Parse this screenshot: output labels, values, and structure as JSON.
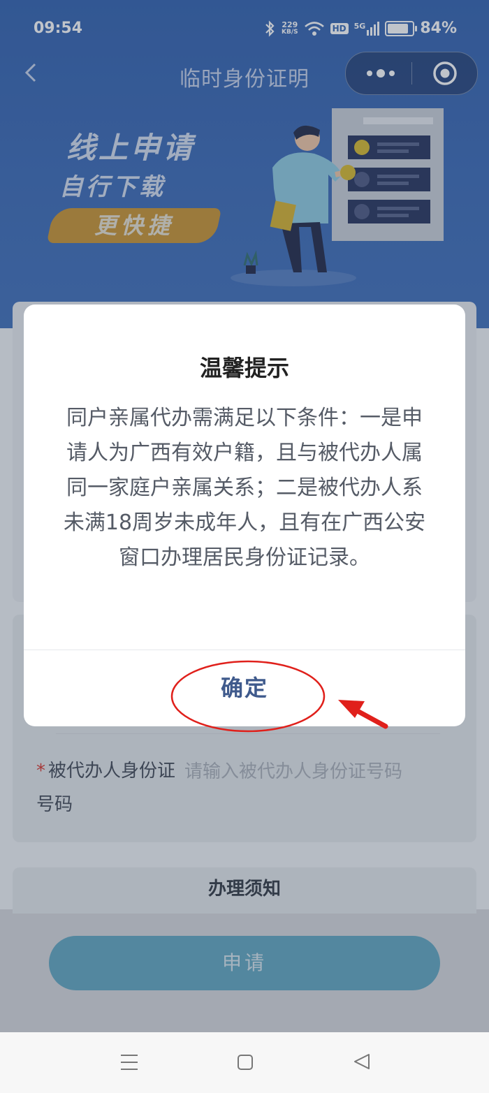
{
  "status_bar": {
    "time": "09:54",
    "network_speed_value": "229",
    "network_speed_unit": "KB/S",
    "hd_label": "HD",
    "signal_label": "5G",
    "battery": "84%",
    "battery_level": 0.84
  },
  "nav": {
    "title": "临时身份证明",
    "back_icon": "chevron-left-icon",
    "more_icon": "more-dots-icon",
    "close_icon": "target-circle-icon"
  },
  "banner": {
    "line1": "线上申请",
    "line2": "自行下载",
    "pill": "更快捷"
  },
  "form": {
    "required_mark": "*",
    "agent_id_label": "被代办人身份证号码",
    "agent_id_placeholder": "请输入被代办人身份证号码"
  },
  "notice": {
    "title": "办理须知"
  },
  "apply_button": "申请",
  "modal": {
    "title": "温馨提示",
    "body": "同户亲属代办需满足以下条件：一是申请人为广西有效户籍，且与被代办人属同一家庭户亲属关系；二是被代办人系未满18周岁未成年人，且有在广西公安窗口办理居民身份证记录。",
    "confirm": "确定"
  },
  "annotation": {
    "circle_color": "#e0201b",
    "arrow_color": "#e0201b"
  },
  "system_nav": [
    "menu-icon",
    "home-square-icon",
    "back-triangle-icon"
  ]
}
